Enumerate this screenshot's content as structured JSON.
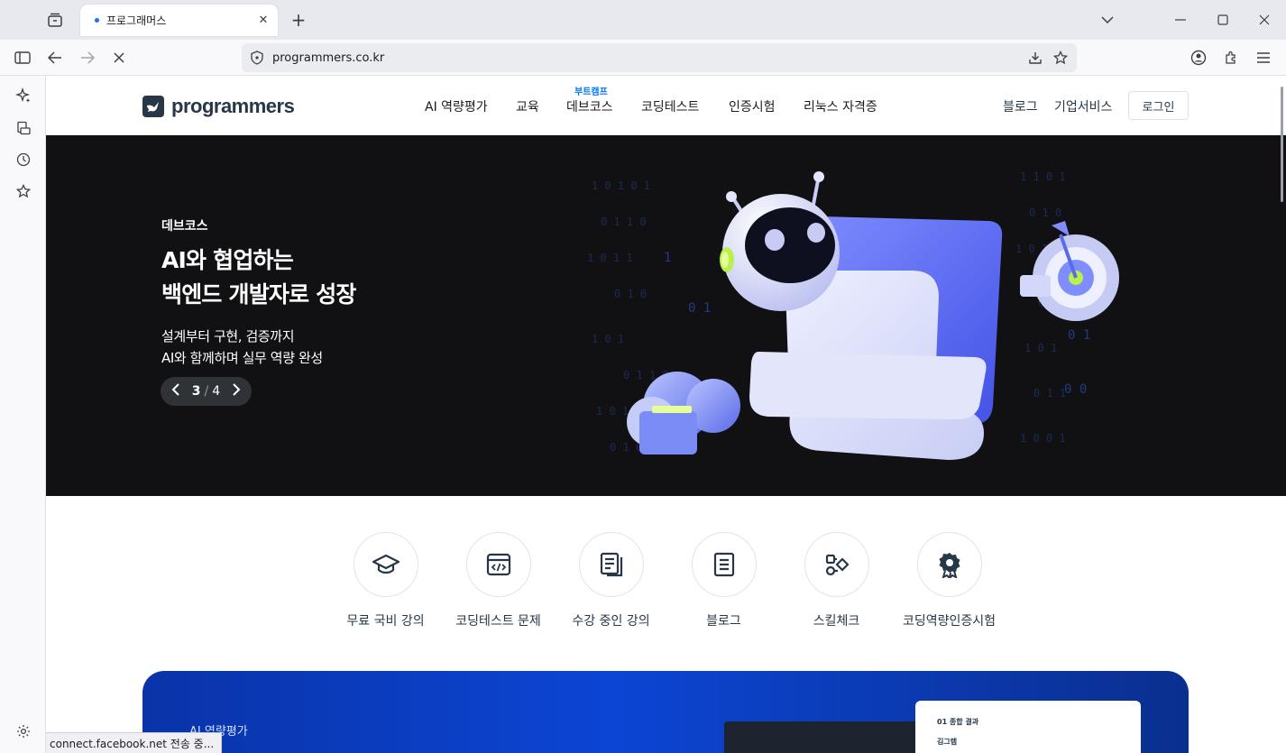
{
  "browser": {
    "tab_title": "프로그래머스",
    "url": "programmers.co.kr",
    "new_tab_symbol": "+",
    "close_symbol": "✕"
  },
  "site": {
    "logo_text": "programmers",
    "nav": {
      "items": [
        "AI 역량평가",
        "교육",
        "데브코스",
        "코딩테스트",
        "인증시험",
        "리눅스 자격증"
      ],
      "badge": "부트캠프"
    },
    "right_links": [
      "블로그",
      "기업서비스"
    ],
    "login": "로그인"
  },
  "hero": {
    "eyebrow": "데브코스",
    "title_line1": "AI와 협업하는",
    "title_line2": "백엔드 개발자로 성장",
    "sub_line1": "설계부터 구현, 검증까지",
    "sub_line2": "AI와 함께하며 실무 역량 완성",
    "pager": {
      "current": "3",
      "separator": "/",
      "total": "4"
    },
    "accent_color": "#5b6cf0"
  },
  "quick_links": [
    {
      "label": "무료 국비 강의",
      "icon": "graduation-cap-icon"
    },
    {
      "label": "코딩테스트 문제",
      "icon": "code-window-icon"
    },
    {
      "label": "수강 중인 강의",
      "icon": "notes-icon"
    },
    {
      "label": "블로그",
      "icon": "document-icon"
    },
    {
      "label": "스킬체크",
      "icon": "skill-shapes-icon"
    },
    {
      "label": "코딩역량인증시험",
      "icon": "badge-icon"
    }
  ],
  "promo": {
    "eyebrow": "AI 역량평가",
    "card_title": "01 종합 결과",
    "card_name": "김그렙"
  },
  "status_text": "connect.facebook.net 전송 중..."
}
